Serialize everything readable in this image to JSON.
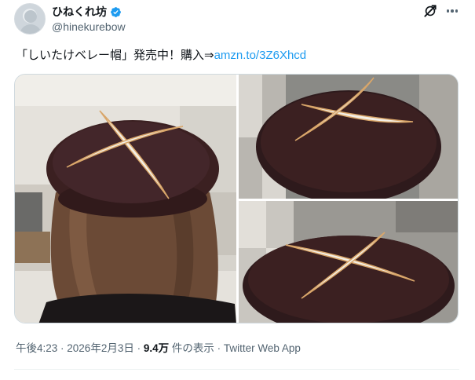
{
  "author": {
    "display_name": "ひねくれ坊",
    "handle": "@hinekurebow",
    "verified": true
  },
  "icons": {
    "verified": "verified-badge-icon",
    "grok": "grok-icon",
    "more": "more-icon"
  },
  "tweet": {
    "text": "「しいたけベレー帽」発売中！購入⇒",
    "link": "amzn.to/3Z6Xhcd"
  },
  "media": [
    {
      "name": "photo-woman-wearing-beret"
    },
    {
      "name": "photo-beret-top-view"
    },
    {
      "name": "photo-beret-side-view"
    }
  ],
  "meta": {
    "time": "午後4:23",
    "separator": " · ",
    "date": "2026年2月3日",
    "views": "9.4万",
    "views_suffix": " 件の表示",
    "source": "Twitter Web App"
  },
  "colors": {
    "accent": "#1d9bf0",
    "text": "#0f1419",
    "secondary": "#536471",
    "beret": "#3b2021",
    "cross": "#f3efe6"
  }
}
